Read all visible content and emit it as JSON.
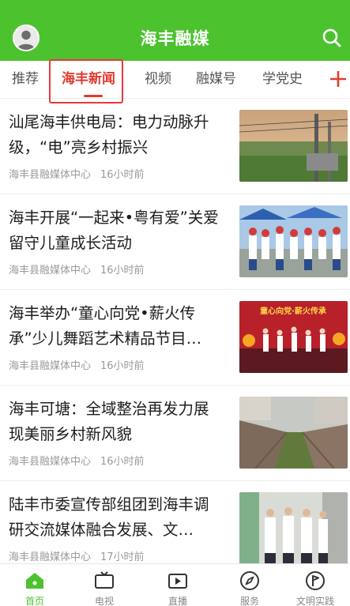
{
  "header": {
    "title": "海丰融媒",
    "avatar_icon": "user-avatar-icon",
    "search_icon": "search-icon",
    "background_color": "#4cc22f"
  },
  "tabs": {
    "items": [
      {
        "label": "推荐"
      },
      {
        "label": "海丰新闻",
        "active": true
      },
      {
        "label": "视频"
      },
      {
        "label": "融媒号"
      },
      {
        "label": "学党史"
      }
    ],
    "add_icon": "plus-icon",
    "active_color": "#e23b2e"
  },
  "news": [
    {
      "title": "汕尾海丰供电局：电力动脉升级，“电”亮乡村振兴",
      "source": "海丰县融媒体中心",
      "time": "16小时前"
    },
    {
      "title": "海丰开展“一起来•粤有爱”关爱留守儿童成长活动",
      "source": "海丰县融媒体中心",
      "time": "16小时前"
    },
    {
      "title": "海丰举办“童心向党•薪火传承”少儿舞蹈艺术精品节目…",
      "source": "海丰县融媒体中心",
      "time": "16小时前",
      "thumb_text": "童心向党·薪火传承"
    },
    {
      "title": "海丰可塘：全域整治再发力展现美丽乡村新风貌",
      "source": "海丰县融媒体中心",
      "time": "16小时前"
    },
    {
      "title": "陆丰市委宣传部组团到海丰调研交流媒体融合发展、文…",
      "source": "海丰县融媒体中心",
      "time": "17小时前"
    }
  ],
  "bottom_nav": [
    {
      "label": "首页",
      "icon": "home-icon",
      "active": true
    },
    {
      "label": "电视",
      "icon": "tv-icon"
    },
    {
      "label": "直播",
      "icon": "live-video-icon"
    },
    {
      "label": "服务",
      "icon": "compass-icon"
    },
    {
      "label": "文明实践",
      "icon": "flag-badge-icon"
    }
  ]
}
